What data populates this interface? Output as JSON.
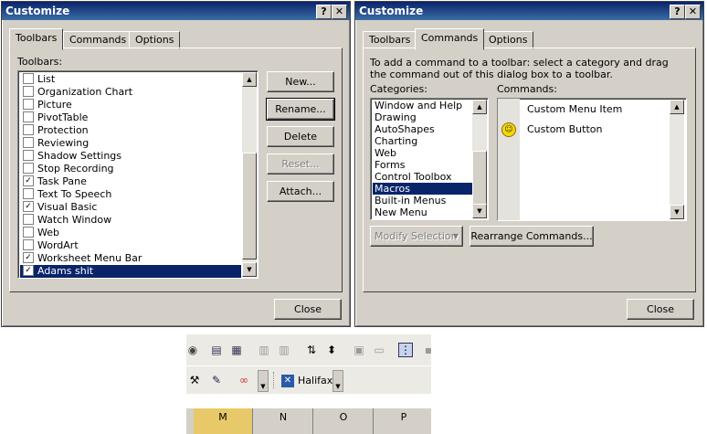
{
  "left_dialog": {
    "title": "Customize",
    "help_glyph": "?",
    "close_glyph": "✕",
    "tabs": [
      {
        "label": "Toolbars",
        "active": true
      },
      {
        "label": "Commands",
        "active": false
      },
      {
        "label": "Options",
        "active": false
      }
    ],
    "list_label": "Toolbars:",
    "toolbars": [
      {
        "label": "List",
        "checked": false
      },
      {
        "label": "Organization Chart",
        "checked": false
      },
      {
        "label": "Picture",
        "checked": false
      },
      {
        "label": "PivotTable",
        "checked": false
      },
      {
        "label": "Protection",
        "checked": false
      },
      {
        "label": "Reviewing",
        "checked": false
      },
      {
        "label": "Shadow Settings",
        "checked": false
      },
      {
        "label": "Stop Recording",
        "checked": false
      },
      {
        "label": "Task Pane",
        "checked": true
      },
      {
        "label": "Text To Speech",
        "checked": false
      },
      {
        "label": "Visual Basic",
        "checked": true
      },
      {
        "label": "Watch Window",
        "checked": false
      },
      {
        "label": "Web",
        "checked": false
      },
      {
        "label": "WordArt",
        "checked": false
      },
      {
        "label": "Worksheet Menu Bar",
        "checked": true
      },
      {
        "label": "Adams shit",
        "checked": true,
        "selected": true
      }
    ],
    "buttons": {
      "new": "New...",
      "rename": "Rename...",
      "delete": "Delete",
      "reset": "Reset...",
      "attach": "Attach..."
    },
    "close": "Close"
  },
  "right_dialog": {
    "title": "Customize",
    "help_glyph": "?",
    "close_glyph": "✕",
    "tabs": [
      {
        "label": "Toolbars",
        "active": false
      },
      {
        "label": "Commands",
        "active": true
      },
      {
        "label": "Options",
        "active": false
      }
    ],
    "instruction": "To add a command to a toolbar: select a category and drag the command out of this dialog box to a toolbar.",
    "categories_label": "Categories:",
    "commands_label": "Commands:",
    "categories": [
      {
        "label": "Window and Help"
      },
      {
        "label": "Drawing"
      },
      {
        "label": "AutoShapes"
      },
      {
        "label": "Charting"
      },
      {
        "label": "Web"
      },
      {
        "label": "Forms"
      },
      {
        "label": "Control Toolbox"
      },
      {
        "label": "Macros",
        "selected": true
      },
      {
        "label": "Built-in Menus"
      },
      {
        "label": "New Menu"
      }
    ],
    "commands": [
      {
        "label": "Custom Menu Item",
        "icon": "none"
      },
      {
        "label": "Custom Button",
        "icon": "smiley-icon"
      }
    ],
    "modify_selection": "Modify Selection",
    "rearrange": "Rearrange Commands...",
    "close": "Close"
  },
  "toolbar_fragment": {
    "custom_button_label": "Halifax",
    "column_headers": [
      "M",
      "N",
      "O",
      "P"
    ]
  }
}
